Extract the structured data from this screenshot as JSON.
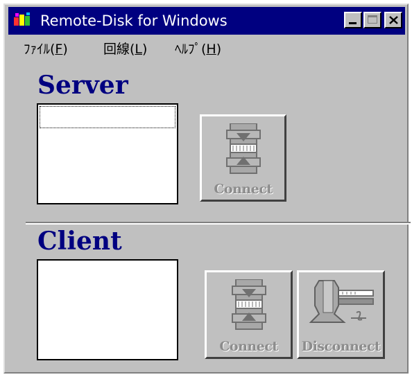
{
  "window": {
    "title": "Remote-Disk for Windows"
  },
  "title_buttons": {
    "minimize": "_",
    "maximize": "□",
    "close": "✕"
  },
  "menu": [
    {
      "label": "ﾌｧｲﾙ(F)",
      "mnemonic": "F"
    },
    {
      "label": "回線(L)",
      "mnemonic": "L"
    },
    {
      "label": "ﾍﾙﾌﾟ(H)",
      "mnemonic": "H"
    }
  ],
  "server": {
    "title": "Server",
    "connect_label": "Connect",
    "connect_icon": "connect-icon"
  },
  "client": {
    "title": "Client",
    "connect_label": "Connect",
    "connect_icon": "connect-icon",
    "disconnect_label": "Disconnect",
    "disconnect_icon": "disconnect-icon"
  },
  "colors": {
    "titlebar": "#000080",
    "face": "#c0c0c0",
    "heading": "#000080",
    "disabled_text": "#8c8c8c"
  }
}
